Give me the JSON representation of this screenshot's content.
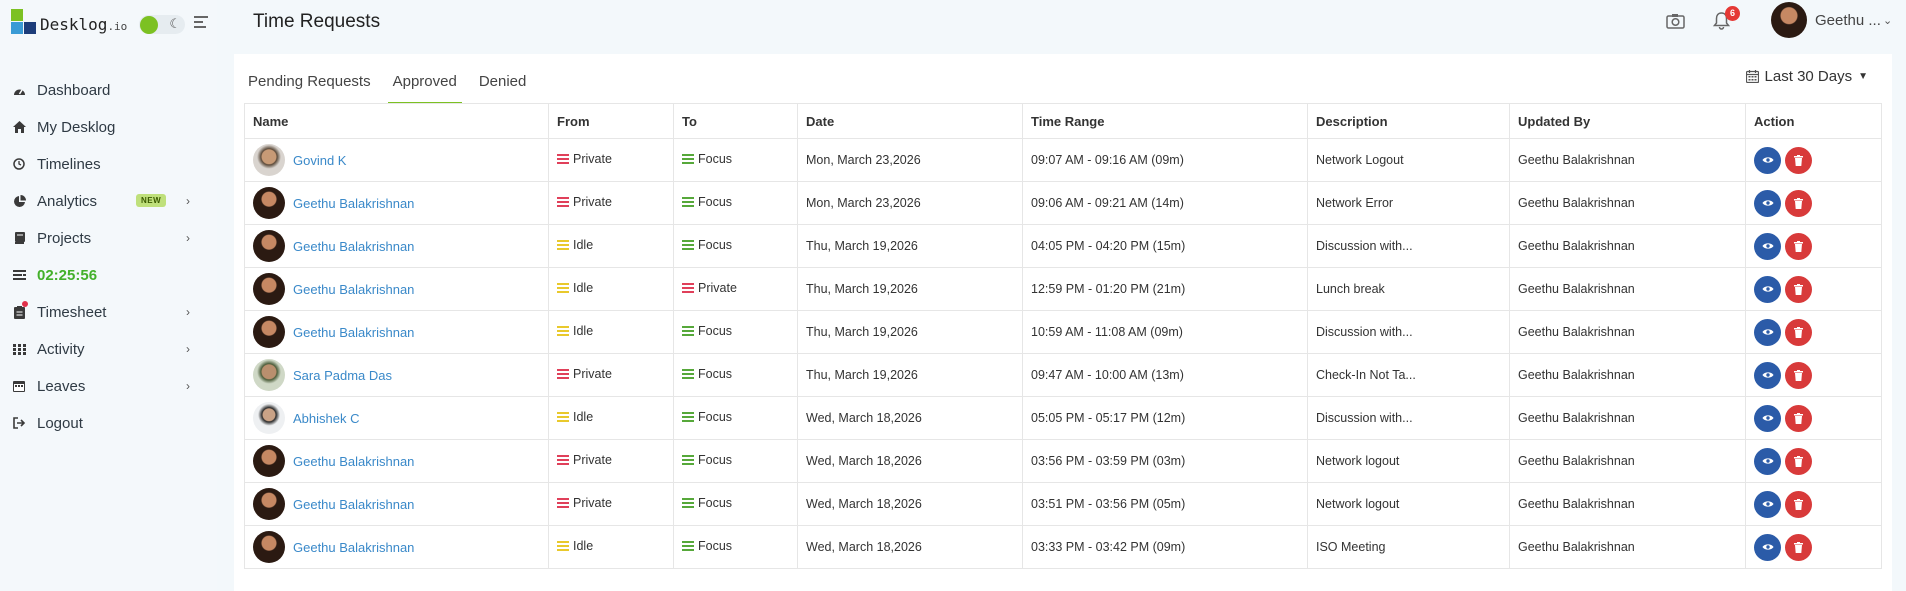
{
  "app": {
    "logo_text": "Desklog",
    "logo_suffix": ".io"
  },
  "sidebar": {
    "items": [
      {
        "label": "Dashboard",
        "icon": "dashboard-icon"
      },
      {
        "label": "My Desklog",
        "icon": "home-icon"
      },
      {
        "label": "Timelines",
        "icon": "clock-icon"
      },
      {
        "label": "Analytics",
        "icon": "pie-chart-icon",
        "badge": "NEW"
      },
      {
        "label": "Projects",
        "icon": "book-icon"
      },
      {
        "label": "02:25:56",
        "icon": "timer-icon"
      },
      {
        "label": "Timesheet",
        "icon": "clipboard-icon"
      },
      {
        "label": "Activity",
        "icon": "grid-icon"
      },
      {
        "label": "Leaves",
        "icon": "calendar-icon"
      },
      {
        "label": "Logout",
        "icon": "logout-icon"
      }
    ]
  },
  "header": {
    "title": "Time Requests",
    "notification_count": "6",
    "user_name": "Geethu ..."
  },
  "tabs": [
    {
      "label": "Pending Requests"
    },
    {
      "label": "Approved"
    },
    {
      "label": "Denied"
    }
  ],
  "date_filter": "Last 30 Days",
  "table": {
    "columns": [
      "Name",
      "From",
      "To",
      "Date",
      "Time Range",
      "Description",
      "Updated By",
      "Action"
    ],
    "rows": [
      {
        "name": "Govind K",
        "from": "Private",
        "to": "Focus",
        "date": "Mon, March 23,2026",
        "time_range": "09:07 AM - 09:16 AM (09m)",
        "description": "Network Logout",
        "updated_by": "Geethu Balakrishnan"
      },
      {
        "name": "Geethu Balakrishnan",
        "from": "Private",
        "to": "Focus",
        "date": "Mon, March 23,2026",
        "time_range": "09:06 AM - 09:21 AM (14m)",
        "description": "Network Error",
        "updated_by": "Geethu Balakrishnan"
      },
      {
        "name": "Geethu Balakrishnan",
        "from": "Idle",
        "to": "Focus",
        "date": "Thu, March 19,2026",
        "time_range": "04:05 PM - 04:20 PM (15m)",
        "description": "Discussion with...",
        "updated_by": "Geethu Balakrishnan"
      },
      {
        "name": "Geethu Balakrishnan",
        "from": "Idle",
        "to": "Private",
        "date": "Thu, March 19,2026",
        "time_range": "12:59 PM - 01:20 PM (21m)",
        "description": "Lunch break",
        "updated_by": "Geethu Balakrishnan"
      },
      {
        "name": "Geethu Balakrishnan",
        "from": "Idle",
        "to": "Focus",
        "date": "Thu, March 19,2026",
        "time_range": "10:59 AM - 11:08 AM (09m)",
        "description": "Discussion with...",
        "updated_by": "Geethu Balakrishnan"
      },
      {
        "name": "Sara Padma Das",
        "from": "Private",
        "to": "Focus",
        "date": "Thu, March 19,2026",
        "time_range": "09:47 AM - 10:00 AM (13m)",
        "description": "Check-In Not Ta...",
        "updated_by": "Geethu Balakrishnan"
      },
      {
        "name": "Abhishek C",
        "from": "Idle",
        "to": "Focus",
        "date": "Wed, March 18,2026",
        "time_range": "05:05 PM - 05:17 PM (12m)",
        "description": "Discussion with...",
        "updated_by": "Geethu Balakrishnan"
      },
      {
        "name": "Geethu Balakrishnan",
        "from": "Private",
        "to": "Focus",
        "date": "Wed, March 18,2026",
        "time_range": "03:56 PM - 03:59 PM (03m)",
        "description": "Network logout",
        "updated_by": "Geethu Balakrishnan"
      },
      {
        "name": "Geethu Balakrishnan",
        "from": "Private",
        "to": "Focus",
        "date": "Wed, March 18,2026",
        "time_range": "03:51 PM - 03:56 PM (05m)",
        "description": "Network logout",
        "updated_by": "Geethu Balakrishnan"
      },
      {
        "name": "Geethu Balakrishnan",
        "from": "Idle",
        "to": "Focus",
        "date": "Wed, March 18,2026",
        "time_range": "03:33 PM - 03:42 PM (09m)",
        "description": "ISO Meeting",
        "updated_by": "Geethu Balakrishnan"
      }
    ]
  },
  "colors": {
    "private": "#e0405a",
    "idle": "#e9c92c",
    "focus": "#56a83a",
    "link": "#3a89c9",
    "accent": "#7cc122",
    "view_button": "#2b5ba8",
    "delete_button": "#d83a3a"
  }
}
